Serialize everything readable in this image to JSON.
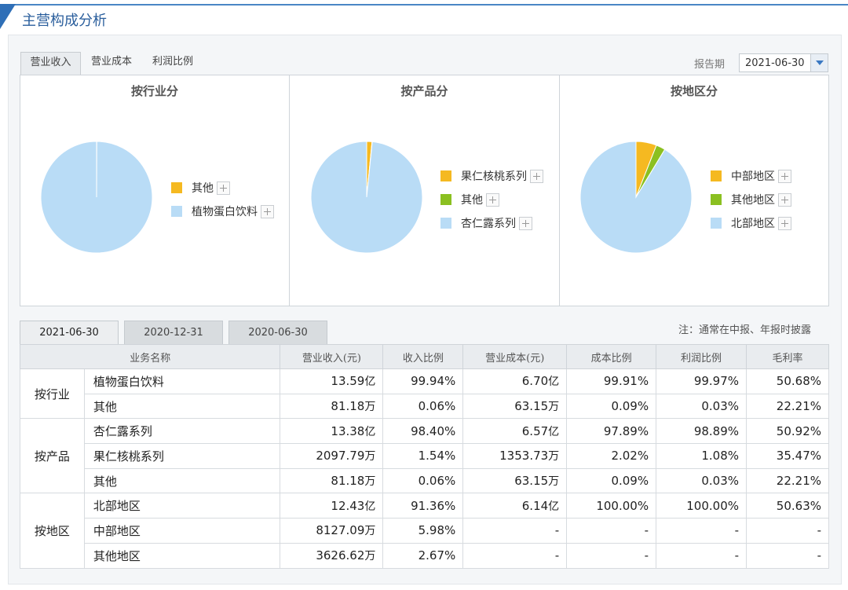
{
  "header": {
    "title": "主营构成分析"
  },
  "top_tabs": [
    "营业收入",
    "营业成本",
    "利润比例"
  ],
  "period": {
    "label": "报告期",
    "value": "2021-06-30"
  },
  "colors": {
    "orange": "#f5b921",
    "green": "#8bc021",
    "blue": "#b9dcf6",
    "accent": "#2f6fb7"
  },
  "charts": [
    {
      "title": "按行业分",
      "legend": [
        {
          "label": "其他",
          "color": "orange"
        },
        {
          "label": "植物蛋白饮料",
          "color": "blue"
        }
      ]
    },
    {
      "title": "按产品分",
      "legend": [
        {
          "label": "果仁核桃系列",
          "color": "orange"
        },
        {
          "label": "其他",
          "color": "green"
        },
        {
          "label": "杏仁露系列",
          "color": "blue"
        }
      ]
    },
    {
      "title": "按地区分",
      "legend": [
        {
          "label": "中部地区",
          "color": "orange"
        },
        {
          "label": "其他地区",
          "color": "green"
        },
        {
          "label": "北部地区",
          "color": "blue"
        }
      ]
    }
  ],
  "chart_data": [
    {
      "type": "pie",
      "title": "按行业分",
      "series": [
        {
          "name": "其他",
          "value": 0.06
        },
        {
          "name": "植物蛋白饮料",
          "value": 99.94
        }
      ]
    },
    {
      "type": "pie",
      "title": "按产品分",
      "series": [
        {
          "name": "果仁核桃系列",
          "value": 1.54
        },
        {
          "name": "其他",
          "value": 0.06
        },
        {
          "name": "杏仁露系列",
          "value": 98.4
        }
      ]
    },
    {
      "type": "pie",
      "title": "按地区分",
      "series": [
        {
          "name": "中部地区",
          "value": 5.98
        },
        {
          "name": "其他地区",
          "value": 2.67
        },
        {
          "name": "北部地区",
          "value": 91.36
        }
      ]
    }
  ],
  "date_tabs": [
    "2021-06-30",
    "2020-12-31",
    "2020-06-30"
  ],
  "note": "注：通常在中报、年报时披露",
  "table": {
    "headers": [
      "业务名称",
      "营业收入(元)",
      "收入比例",
      "营业成本(元)",
      "成本比例",
      "利润比例",
      "毛利率"
    ],
    "groups": [
      {
        "name": "按行业",
        "rows": [
          {
            "name": "植物蛋白饮料",
            "revenue": "13.59",
            "revenue_unit": "亿",
            "rev_ratio": "99.94%",
            "cost": "6.70",
            "cost_unit": "亿",
            "cost_ratio": "99.91%",
            "profit_ratio": "99.97%",
            "margin": "50.68%"
          },
          {
            "name": "其他",
            "revenue": "81.18",
            "revenue_unit": "万",
            "rev_ratio": "0.06%",
            "cost": "63.15",
            "cost_unit": "万",
            "cost_ratio": "0.09%",
            "profit_ratio": "0.03%",
            "margin": "22.21%"
          }
        ]
      },
      {
        "name": "按产品",
        "rows": [
          {
            "name": "杏仁露系列",
            "revenue": "13.38",
            "revenue_unit": "亿",
            "rev_ratio": "98.40%",
            "cost": "6.57",
            "cost_unit": "亿",
            "cost_ratio": "97.89%",
            "profit_ratio": "98.89%",
            "margin": "50.92%"
          },
          {
            "name": "果仁核桃系列",
            "revenue": "2097.79",
            "revenue_unit": "万",
            "rev_ratio": "1.54%",
            "cost": "1353.73",
            "cost_unit": "万",
            "cost_ratio": "2.02%",
            "profit_ratio": "1.08%",
            "margin": "35.47%"
          },
          {
            "name": "其他",
            "revenue": "81.18",
            "revenue_unit": "万",
            "rev_ratio": "0.06%",
            "cost": "63.15",
            "cost_unit": "万",
            "cost_ratio": "0.09%",
            "profit_ratio": "0.03%",
            "margin": "22.21%"
          }
        ]
      },
      {
        "name": "按地区",
        "rows": [
          {
            "name": "北部地区",
            "revenue": "12.43",
            "revenue_unit": "亿",
            "rev_ratio": "91.36%",
            "cost": "6.14",
            "cost_unit": "亿",
            "cost_ratio": "100.00%",
            "profit_ratio": "100.00%",
            "margin": "50.63%"
          },
          {
            "name": "中部地区",
            "revenue": "8127.09",
            "revenue_unit": "万",
            "rev_ratio": "5.98%",
            "cost": "-",
            "cost_unit": "",
            "cost_ratio": "-",
            "profit_ratio": "-",
            "margin": "-"
          },
          {
            "name": "其他地区",
            "revenue": "3626.62",
            "revenue_unit": "万",
            "rev_ratio": "2.67%",
            "cost": "-",
            "cost_unit": "",
            "cost_ratio": "-",
            "profit_ratio": "-",
            "margin": "-"
          }
        ]
      }
    ]
  }
}
